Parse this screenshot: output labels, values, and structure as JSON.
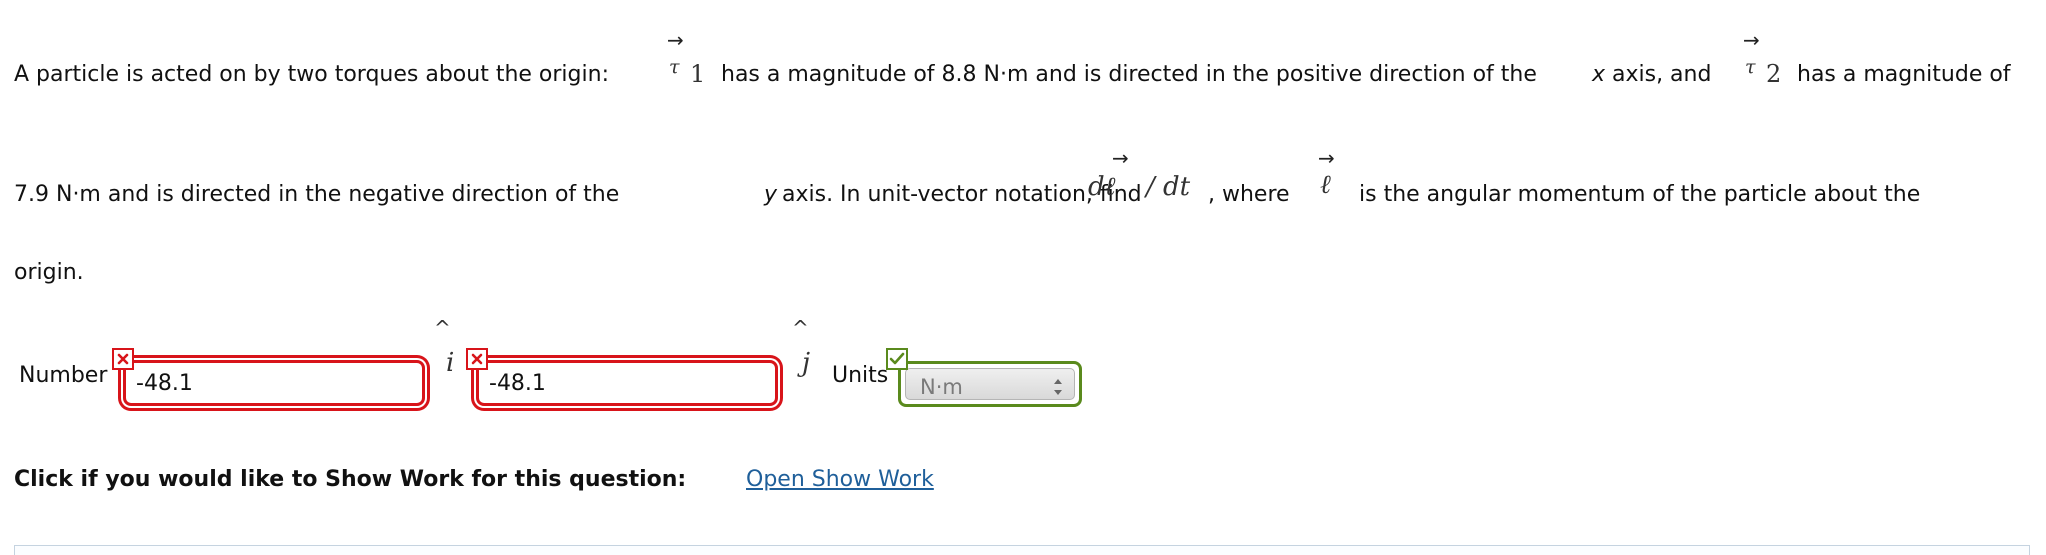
{
  "question": {
    "line1_a": "A particle is acted on by two torques about the origin:",
    "tau_symbol": "τ",
    "tau1_sub": "1",
    "line1_b": "has a magnitude of 8.8 N·m and is directed in the positive direction of the",
    "x_var": "x",
    "line1_c": "axis, and",
    "tau2_sub": "2",
    "line1_d": "has a magnitude of",
    "line2_a": "7.9 N·m and is directed in the negative direction of the",
    "y_var": "y",
    "line2_b": "axis. In unit-vector notation, find",
    "deriv_num": "dℓ",
    "deriv_rest": "/ dt",
    "line2_c": ", where",
    "ell_symbol": "ℓ",
    "line2_d": "is the angular momentum of the particle about the",
    "line3": "origin.",
    "arrow_glyph": "→",
    "hat_glyph": "^"
  },
  "answer": {
    "number_label": "Number",
    "i_unit": "i",
    "j_unit": "j",
    "i_value": "-48.1",
    "j_value": "-48.1",
    "units_label": "Units",
    "units_value": "N·m",
    "i_status": "incorrect",
    "j_status": "incorrect",
    "units_status": "correct",
    "incorrect_color": "#d8141a",
    "correct_color": "#5a8a1d"
  },
  "show_work": {
    "prompt": "Click if you would like to Show Work for this question:",
    "link_label": "Open Show Work"
  }
}
